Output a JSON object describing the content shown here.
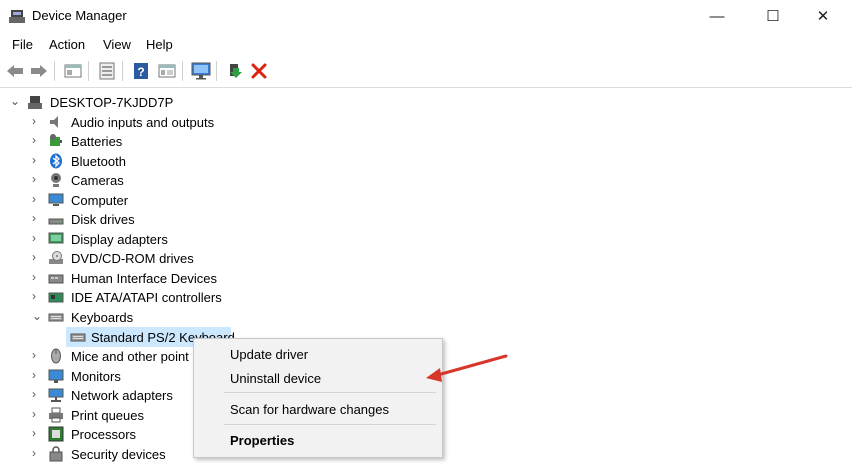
{
  "window": {
    "title": "Device Manager",
    "minimize": "—",
    "maximize": "☐",
    "close": "✕"
  },
  "menu": [
    "File",
    "Action",
    "View",
    "Help"
  ],
  "toolbar": [
    "back-icon",
    "forward-icon",
    "properties-icon",
    "update-icon",
    "help-icon",
    "view-icon",
    "monitor-icon",
    "enable-icon",
    "remove-icon"
  ],
  "tree": {
    "root": "DESKTOP-7KJDD7P",
    "items": [
      {
        "label": "Audio inputs and outputs",
        "icon": "speaker-icon"
      },
      {
        "label": "Batteries",
        "icon": "battery-icon"
      },
      {
        "label": "Bluetooth",
        "icon": "bluetooth-icon"
      },
      {
        "label": "Cameras",
        "icon": "camera-icon"
      },
      {
        "label": "Computer",
        "icon": "computer-icon"
      },
      {
        "label": "Disk drives",
        "icon": "disk-icon"
      },
      {
        "label": "Display adapters",
        "icon": "display-adapter-icon"
      },
      {
        "label": "DVD/CD-ROM drives",
        "icon": "dvd-icon"
      },
      {
        "label": "Human Interface Devices",
        "icon": "hid-icon"
      },
      {
        "label": "IDE ATA/ATAPI controllers",
        "icon": "ide-icon"
      },
      {
        "label": "Keyboards",
        "icon": "keyboard-icon",
        "expanded": true
      },
      {
        "label": "Standard PS/2 Keyboard",
        "icon": "keyboard-icon",
        "child": true
      },
      {
        "label": "Mice and other point",
        "icon": "mouse-icon"
      },
      {
        "label": "Monitors",
        "icon": "monitor-icon"
      },
      {
        "label": "Network adapters",
        "icon": "network-icon"
      },
      {
        "label": "Print queues",
        "icon": "printer-icon"
      },
      {
        "label": "Processors",
        "icon": "processor-icon"
      },
      {
        "label": "Security devices",
        "icon": "security-icon"
      }
    ]
  },
  "context_menu": {
    "update": "Update driver",
    "uninstall": "Uninstall device",
    "scan": "Scan for hardware changes",
    "properties": "Properties"
  }
}
